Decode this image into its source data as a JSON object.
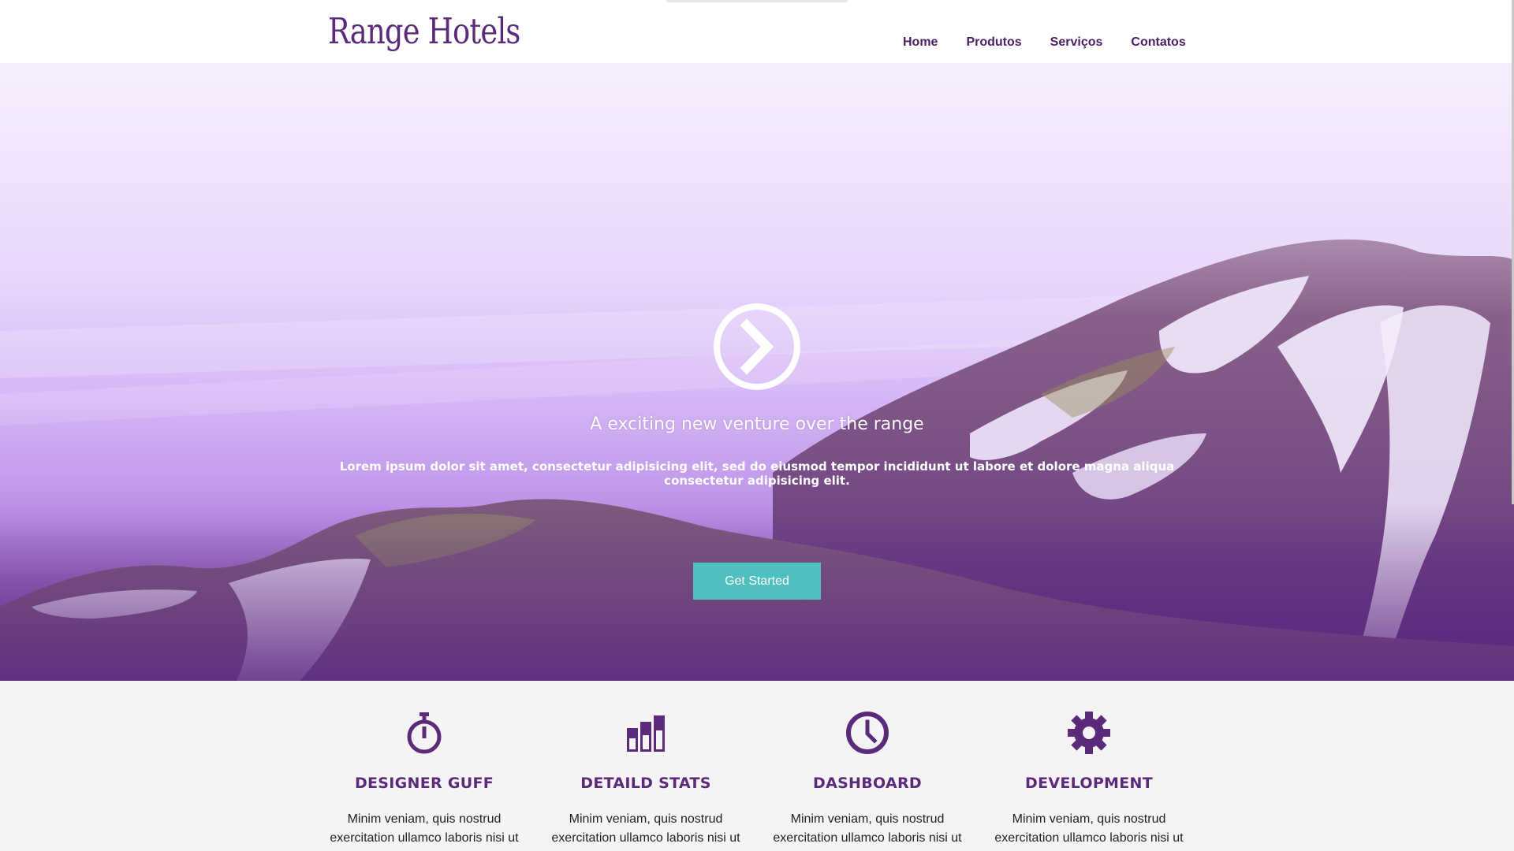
{
  "header": {
    "logo": "Range Hotels",
    "nav": [
      "Home",
      "Produtos",
      "Serviços",
      "Contatos"
    ]
  },
  "hero": {
    "title": "A exciting new venture over the range",
    "text": "Lorem ipsum dolor sit amet, consectetur adipisicing elit, sed do eiusmod tempor incididunt ut labore et dolore magna aliqua consectetur adipisicing elit.",
    "cta_label": "Get Started",
    "icon": "chevron-right-circle-icon"
  },
  "features": [
    {
      "icon": "stopwatch-icon",
      "title": "DESIGNER GUFF",
      "text": "Minim veniam, quis nostrud exercitation ullamco laboris nisi ut"
    },
    {
      "icon": "bar-chart-icon",
      "title": "DETAILD STATS",
      "text": "Minim veniam, quis nostrud exercitation ullamco laboris nisi ut"
    },
    {
      "icon": "clock-icon",
      "title": "DASHBOARD",
      "text": "Minim veniam, quis nostrud exercitation ullamco laboris nisi ut"
    },
    {
      "icon": "gear-icon",
      "title": "DEVELOPMENT",
      "text": "Minim veniam, quis nostrud exercitation ullamco laboris nisi ut"
    }
  ],
  "colors": {
    "brand": "#5b2a7a",
    "accent": "#4fc0bf",
    "hero_top": "#f4ecfb",
    "hero_bottom": "#6a3390"
  }
}
